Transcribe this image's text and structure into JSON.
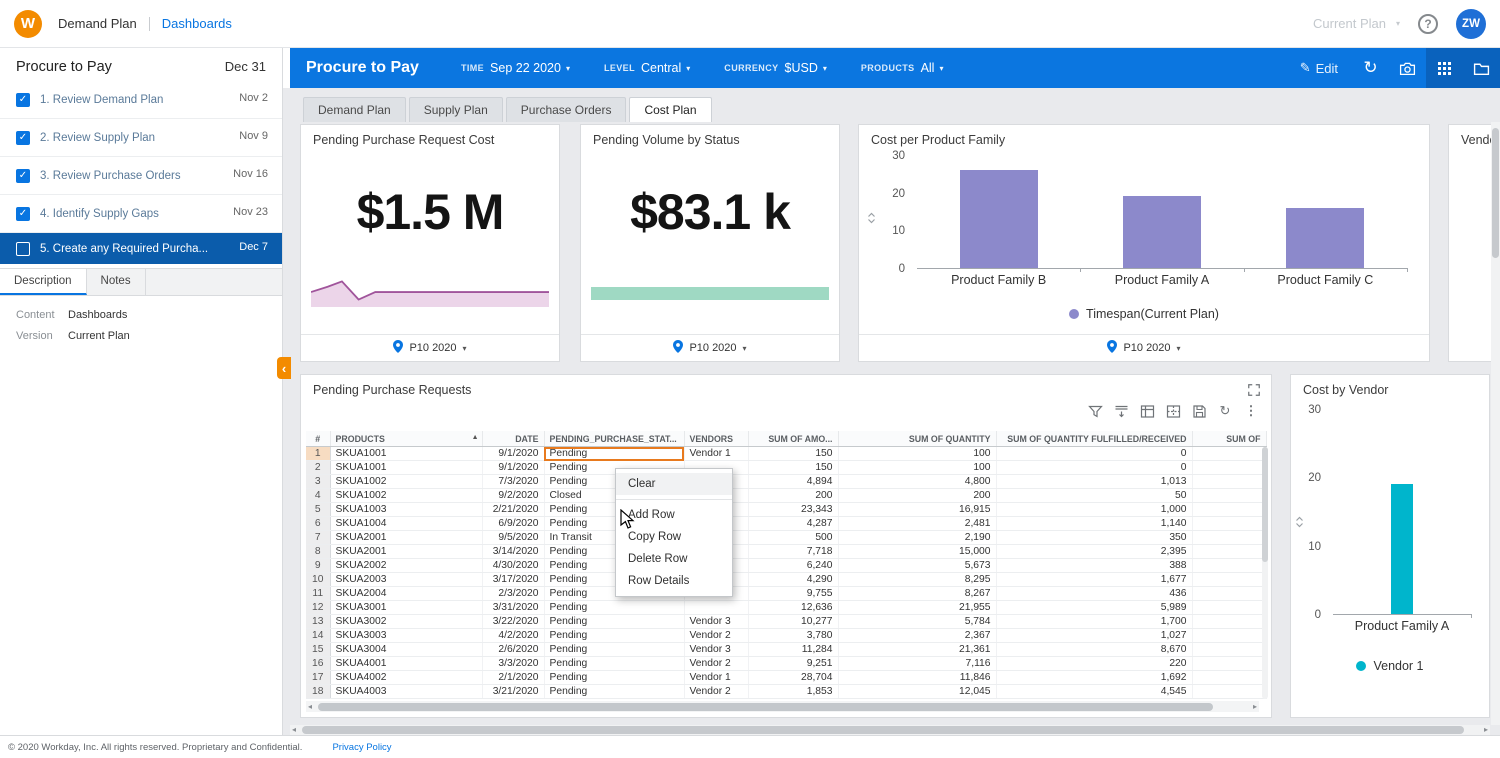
{
  "topbar": {
    "logo_letter": "W",
    "breadcrumb": {
      "primary": "Demand Plan",
      "secondary": "Dashboards"
    },
    "plan_selector": "Current Plan",
    "avatar_initials": "ZW"
  },
  "sidebar": {
    "title": "Procure to Pay",
    "due_date": "Dec 31",
    "checklist": [
      {
        "label": "1. Review Demand Plan",
        "date": "Nov 2",
        "checked": true,
        "selected": false
      },
      {
        "label": "2. Review Supply Plan",
        "date": "Nov 9",
        "checked": true,
        "selected": false
      },
      {
        "label": "3. Review Purchase Orders",
        "date": "Nov 16",
        "checked": true,
        "selected": false
      },
      {
        "label": "4. Identify Supply Gaps",
        "date": "Nov 23",
        "checked": true,
        "selected": false
      },
      {
        "label": "5. Create any Required Purcha...",
        "date": "Dec 7",
        "checked": false,
        "selected": true
      }
    ],
    "tabs": [
      {
        "label": "Description",
        "active": true
      },
      {
        "label": "Notes",
        "active": false
      }
    ],
    "details": [
      {
        "label": "Content",
        "value": "Dashboards"
      },
      {
        "label": "Version",
        "value": "Current Plan"
      }
    ]
  },
  "dashboard_header": {
    "title": "Procure to Pay",
    "filters": [
      {
        "label": "TIME",
        "value": "Sep 22 2020"
      },
      {
        "label": "LEVEL",
        "value": "Central"
      },
      {
        "label": "CURRENCY",
        "value": "$USD"
      },
      {
        "label": "PRODUCTS",
        "value": "All"
      }
    ],
    "edit_label": "Edit",
    "icons": [
      "edit-icon",
      "refresh-icon",
      "camera-icon",
      "apps-grid-icon",
      "folder-icon"
    ]
  },
  "dashboard_tabs": [
    {
      "label": "Demand Plan",
      "active": false
    },
    {
      "label": "Supply Plan",
      "active": false
    },
    {
      "label": "Purchase Orders",
      "active": false
    },
    {
      "label": "Cost Plan",
      "active": true
    }
  ],
  "kpi_cards": [
    {
      "title": "Pending Purchase Request Cost",
      "value": "$1.5 M",
      "period": "P10 2020"
    },
    {
      "title": "Pending Volume by Status",
      "value": "$83.1 k",
      "period": "P10 2020"
    }
  ],
  "family_chart_card": {
    "title": "Cost per Product Family",
    "legend": "Timespan(Current Plan)",
    "period": "P10 2020"
  },
  "partial_card": {
    "title": "Vendor"
  },
  "table_card": {
    "title": "Pending Purchase Requests",
    "toolbar_icons": [
      "filter-icon",
      "fill-down-icon",
      "freeze-panes-icon",
      "table-borders-icon",
      "save-icon",
      "refresh-icon",
      "more-vertical-icon"
    ],
    "columns": [
      "#",
      "PRODUCTS",
      "DATE",
      "PENDING_PURCHASE_STAT...",
      "VENDORS",
      "SUM OF AMO...",
      "SUM OF QUANTITY",
      "SUM OF QUANTITY FULFILLED/RECEIVED",
      "SUM OF"
    ],
    "sorted_column": "PRODUCTS",
    "selected_cell": {
      "row": 1,
      "column": "PENDING_PURCHASE_STAT..."
    },
    "rows": [
      [
        "1",
        "SKUA1001",
        "9/1/2020",
        "Pending",
        "Vendor 1",
        "150",
        "100",
        "0",
        ""
      ],
      [
        "2",
        "SKUA1001",
        "9/1/2020",
        "Pending",
        "",
        "150",
        "100",
        "0",
        ""
      ],
      [
        "3",
        "SKUA1002",
        "7/3/2020",
        "Pending",
        "",
        "4,894",
        "4,800",
        "1,013",
        ""
      ],
      [
        "4",
        "SKUA1002",
        "9/2/2020",
        "Closed",
        "",
        "200",
        "200",
        "50",
        ""
      ],
      [
        "5",
        "SKUA1003",
        "2/21/2020",
        "Pending",
        "",
        "23,343",
        "16,915",
        "1,000",
        ""
      ],
      [
        "6",
        "SKUA1004",
        "6/9/2020",
        "Pending",
        "",
        "4,287",
        "2,481",
        "1,140",
        ""
      ],
      [
        "7",
        "SKUA2001",
        "9/5/2020",
        "In Transit",
        "",
        "500",
        "2,190",
        "350",
        ""
      ],
      [
        "8",
        "SKUA2001",
        "3/14/2020",
        "Pending",
        "",
        "7,718",
        "15,000",
        "2,395",
        ""
      ],
      [
        "9",
        "SKUA2002",
        "4/30/2020",
        "Pending",
        "",
        "6,240",
        "5,673",
        "388",
        ""
      ],
      [
        "10",
        "SKUA2003",
        "3/17/2020",
        "Pending",
        "",
        "4,290",
        "8,295",
        "1,677",
        ""
      ],
      [
        "11",
        "SKUA2004",
        "2/3/2020",
        "Pending",
        "",
        "9,755",
        "8,267",
        "436",
        ""
      ],
      [
        "12",
        "SKUA3001",
        "3/31/2020",
        "Pending",
        "",
        "12,636",
        "21,955",
        "5,989",
        ""
      ],
      [
        "13",
        "SKUA3002",
        "3/22/2020",
        "Pending",
        "Vendor 3",
        "10,277",
        "5,784",
        "1,700",
        ""
      ],
      [
        "14",
        "SKUA3003",
        "4/2/2020",
        "Pending",
        "Vendor 2",
        "3,780",
        "2,367",
        "1,027",
        ""
      ],
      [
        "15",
        "SKUA3004",
        "2/6/2020",
        "Pending",
        "Vendor 3",
        "11,284",
        "21,361",
        "8,670",
        ""
      ],
      [
        "16",
        "SKUA4001",
        "3/3/2020",
        "Pending",
        "Vendor 2",
        "9,251",
        "7,116",
        "220",
        ""
      ],
      [
        "17",
        "SKUA4002",
        "2/1/2020",
        "Pending",
        "Vendor 1",
        "28,704",
        "11,846",
        "1,692",
        ""
      ],
      [
        "18",
        "SKUA4003",
        "3/21/2020",
        "Pending",
        "Vendor 2",
        "1,853",
        "12,045",
        "4,545",
        ""
      ]
    ]
  },
  "context_menu": {
    "items": [
      "Clear",
      "Add Row",
      "Copy Row",
      "Delete Row",
      "Row Details"
    ]
  },
  "vendor_chart_card": {
    "title": "Cost by Vendor",
    "legend": "Vendor 1"
  },
  "page_footer": {
    "copyright": "© 2020 Workday, Inc. All rights reserved. Proprietary and Confidential.",
    "privacy_link": "Privacy Policy"
  },
  "colors": {
    "header_blue": "#0b76e0",
    "header_blue_dark": "#0a62bd",
    "link_blue": "#0875e1",
    "selected_item_blue": "#0b5cab",
    "workday_orange": "#f38b00",
    "cell_selection_orange": "#e87a1e",
    "purple_bar": "#8c89cb",
    "teal_bar": "#00b5cc"
  },
  "chart_data": [
    {
      "id": "pending_cost_trend",
      "type": "area",
      "title": "Pending Purchase Request Cost",
      "kpi_value": "$1.5 M",
      "points": [
        [
          0,
          16
        ],
        [
          7,
          11
        ],
        [
          13,
          6
        ],
        [
          20,
          23
        ],
        [
          27,
          16
        ],
        [
          100,
          16
        ]
      ],
      "line_color": "#a0549b",
      "fill_color": "#ecd5e9"
    },
    {
      "id": "pending_volume_band",
      "type": "bar",
      "title": "Pending Volume by Status",
      "kpi_value": "$83.1 k",
      "values": [
        1
      ],
      "bar_color": "#9fd9c3"
    },
    {
      "id": "cost_per_product_family",
      "type": "bar",
      "title": "Cost per Product Family",
      "categories": [
        "Product Family B",
        "Product Family A",
        "Product Family C"
      ],
      "values": [
        26,
        19,
        16
      ],
      "ylim": [
        0,
        30
      ],
      "yticks": [
        0,
        10,
        20,
        30
      ],
      "legend": [
        {
          "label": "Timespan(Current Plan)",
          "color": "#8c89cb"
        }
      ],
      "bar_color": "#8c89cb"
    },
    {
      "id": "cost_by_vendor",
      "type": "bar",
      "title": "Cost by Vendor",
      "categories": [
        "Product Family A"
      ],
      "values": [
        19
      ],
      "ylim": [
        0,
        30
      ],
      "yticks": [
        0,
        10,
        20,
        30
      ],
      "legend": [
        {
          "label": "Vendor 1",
          "color": "#00b5cc"
        }
      ],
      "bar_color": "#00b5cc"
    }
  ]
}
